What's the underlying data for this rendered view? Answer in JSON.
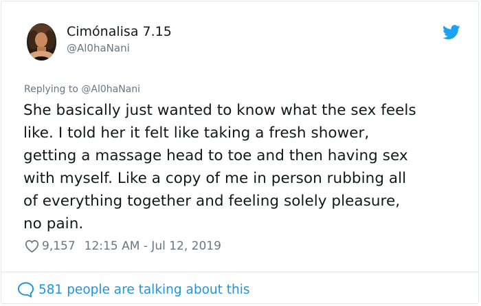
{
  "user": {
    "display_name": "Cimónalisa 7.15",
    "handle": "@Al0haNani"
  },
  "tweet": {
    "replying_to": "Replying to @Al0haNani",
    "text": "She basically just wanted to know what the sex feels\nlike. I told her it felt like taking a fresh shower,\ngetting a massage head to toe and then having sex\nwith myself. Like a copy of me in person rubbing all\nof everything together and feeling solely pleasure,\nno pain.",
    "likes": "9,157",
    "timestamp": "12:15 AM - Jul 12, 2019"
  },
  "footer": {
    "conversation_text": "581 people are talking about this"
  },
  "icons": {
    "brand": "twitter-bird-icon",
    "like": "heart-icon",
    "conversation": "speech-bubble-icon"
  },
  "colors": {
    "brand_blue": "#1da1f2",
    "link_blue": "#1b95e0",
    "secondary_text": "#657786",
    "primary_text": "#14171a",
    "border": "#e1e8ed"
  }
}
